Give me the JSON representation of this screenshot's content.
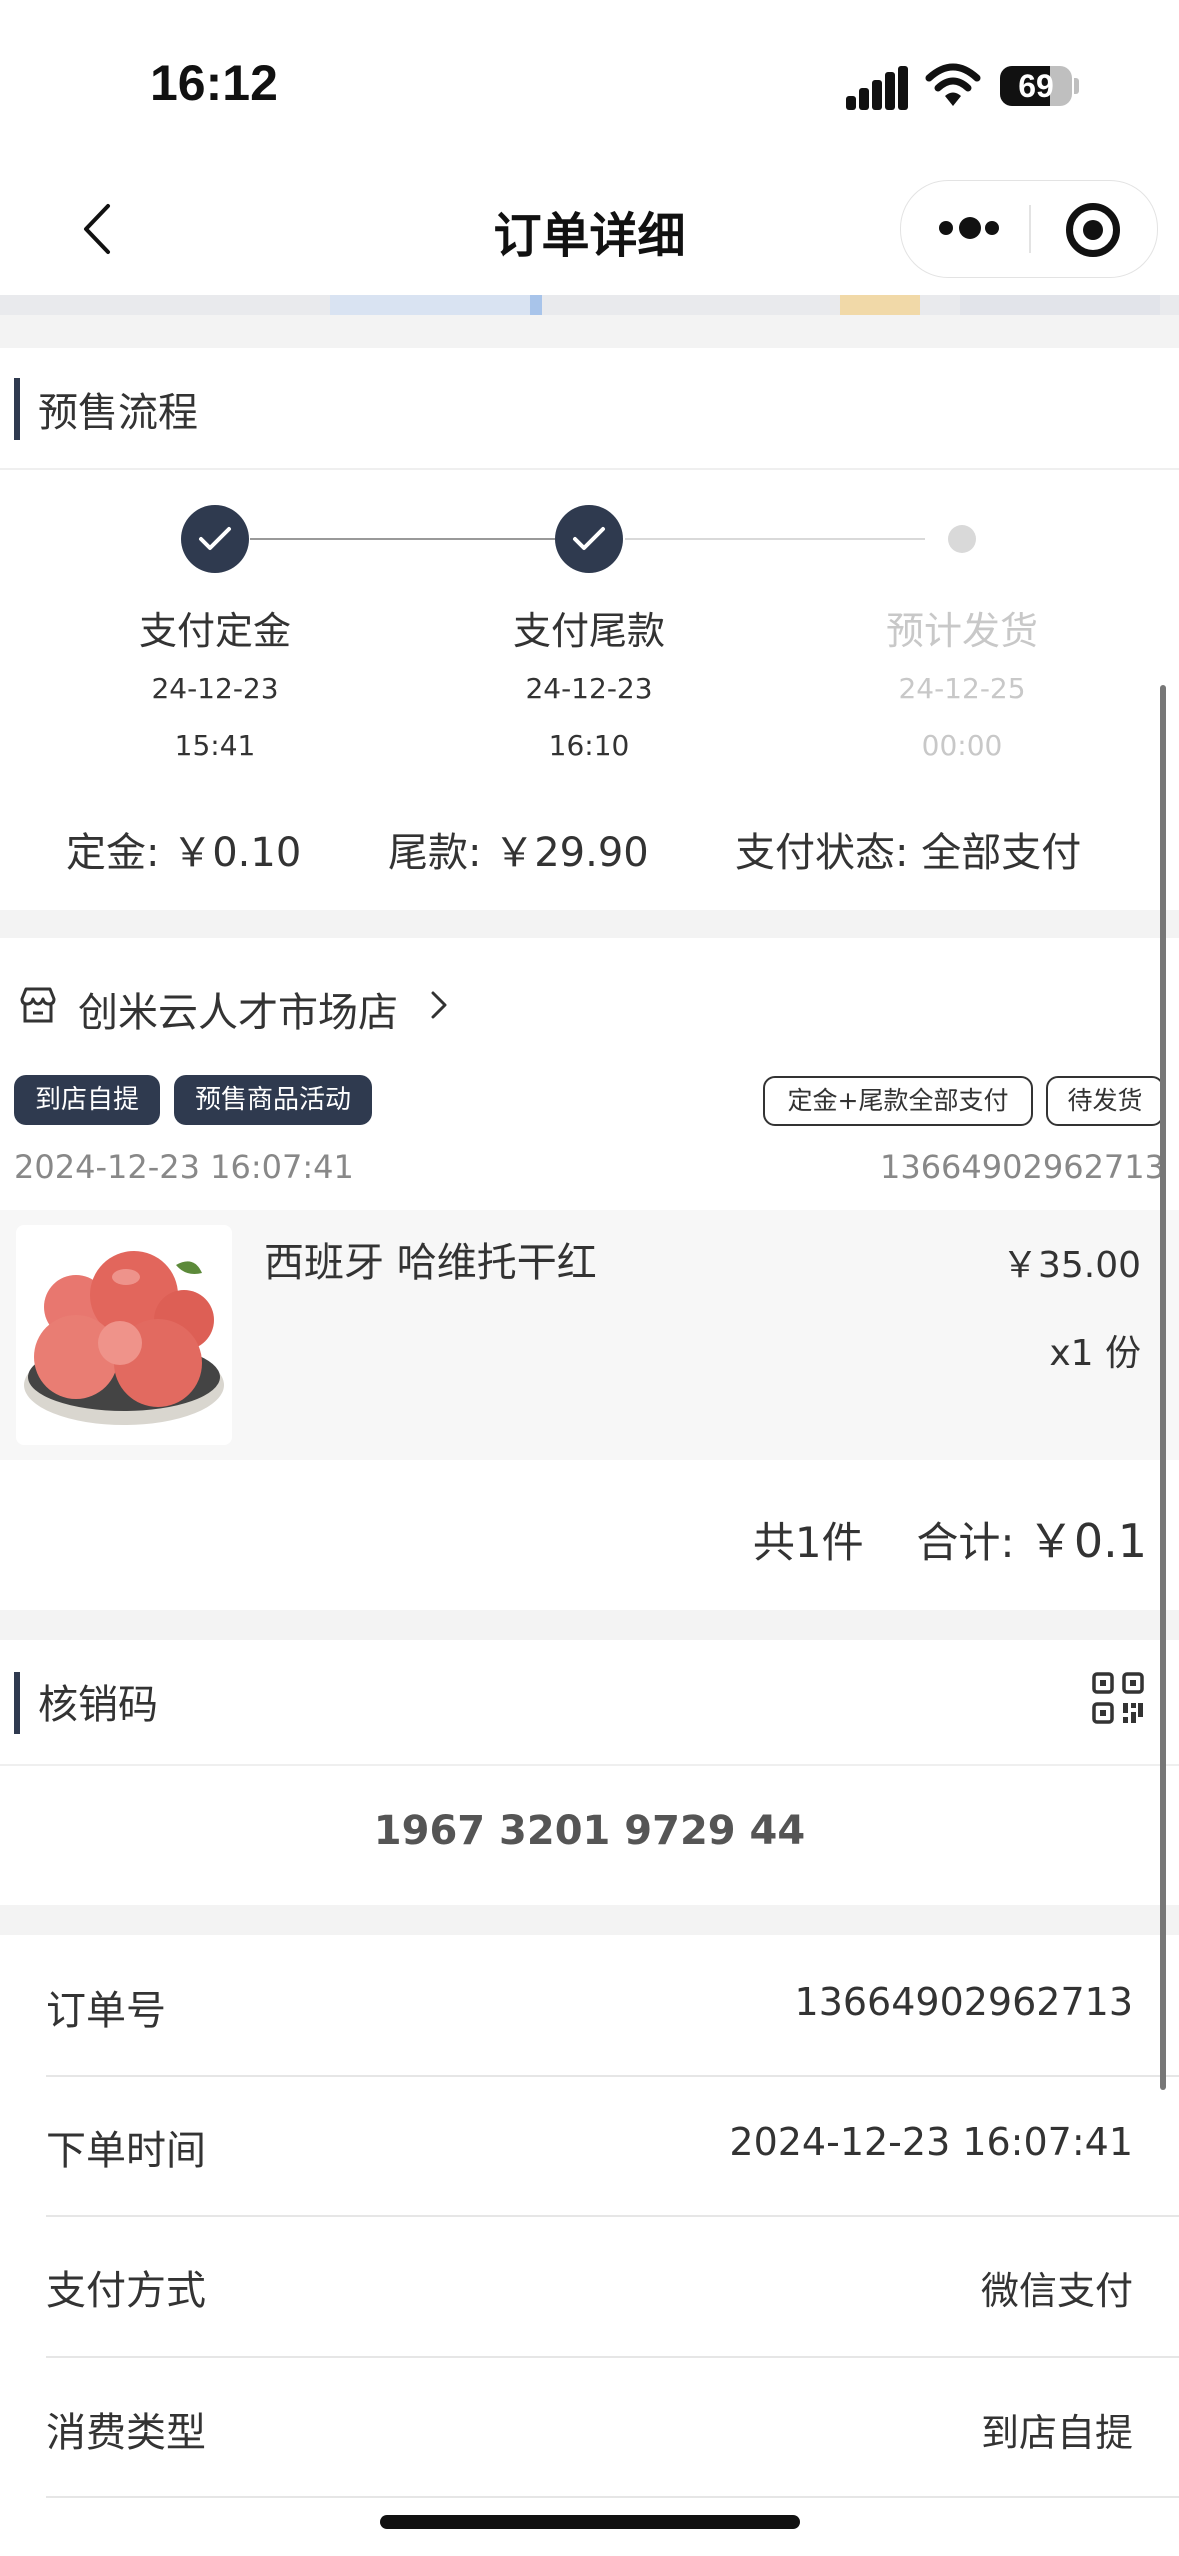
{
  "status_bar": {
    "time": "16:12",
    "battery": "69",
    "battery_level": 0.69
  },
  "nav": {
    "title": "订单详细"
  },
  "presale": {
    "title": "预售流程",
    "steps": [
      {
        "label": "支付定金",
        "date": "24-12-23",
        "time": "15:41",
        "done": true
      },
      {
        "label": "支付尾款",
        "date": "24-12-23",
        "time": "16:10",
        "done": true
      },
      {
        "label": "预计发货",
        "date": "24-12-25",
        "time": "00:00",
        "done": false
      }
    ],
    "deposit_label": "定金:",
    "deposit_value": "￥0.10",
    "balance_label": "尾款:",
    "balance_value": "￥29.90",
    "pay_status_label": "支付状态:",
    "pay_status_value": "全部支付"
  },
  "order_card": {
    "store_name": "创米云人才市场店",
    "tags_left": [
      "到店自提",
      "预售商品活动"
    ],
    "tags_right": [
      "定金+尾款全部支付",
      "待发货"
    ],
    "created_at": "2024-12-23 16:07:41",
    "order_no": "13664902962713",
    "product": {
      "name": "西班牙 哈维托干红",
      "price": "￥35.00",
      "qty": "x1 份"
    },
    "summary_count": "共1件",
    "summary_total_label": "合计:",
    "summary_total_value": "￥0.1"
  },
  "verify": {
    "title": "核销码",
    "code": "1967 3201 9729 44"
  },
  "info": [
    {
      "label": "订单号",
      "value": "13664902962713"
    },
    {
      "label": "下单时间",
      "value": "2024-12-23 16:07:41"
    },
    {
      "label": "支付方式",
      "value": "微信支付"
    },
    {
      "label": "消费类型",
      "value": "到店自提"
    }
  ],
  "colors": {
    "accent": "#2f3a4f",
    "background": "#f3f3f3",
    "muted": "#c8c8c8"
  }
}
